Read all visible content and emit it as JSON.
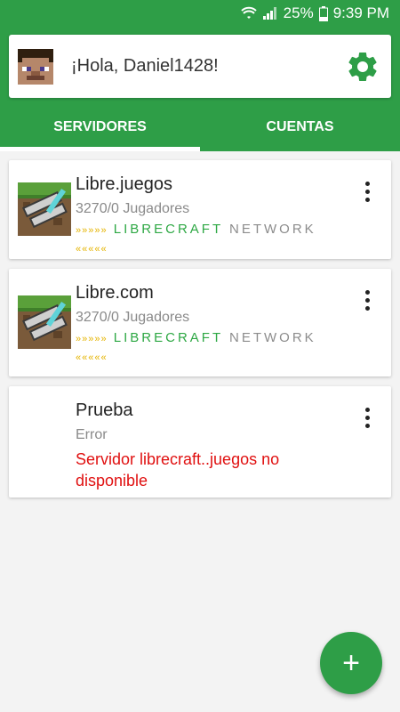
{
  "status_bar": {
    "battery": "25%",
    "time": "9:39 PM",
    "icons": [
      "wifi-icon",
      "signal-icon",
      "battery-icon"
    ]
  },
  "header": {
    "greeting": "¡Hola, Daniel1428!",
    "settings_icon": "gear-icon"
  },
  "tabs": [
    {
      "label": "SERVIDORES",
      "active": true
    },
    {
      "label": "CUENTAS",
      "active": false
    }
  ],
  "servers": [
    {
      "name": "Libre.juegos",
      "players": "3270/0 Jugadores",
      "motd": {
        "arrows_left": "»»»»»",
        "name_green": "LIBRECRAFT",
        "name_gray": "NETWORK",
        "arrows_right": "«««««"
      }
    },
    {
      "name": "Libre.com",
      "players": "3270/0 Jugadores",
      "motd": {
        "arrows_left": "»»»»»",
        "name_green": "LIBRECRAFT",
        "name_gray": "NETWORK",
        "arrows_right": "«««««"
      }
    },
    {
      "name": "Prueba",
      "status": "Error",
      "error_message": "Servidor librecraft..juegos no disponible"
    }
  ],
  "fab": {
    "label": "+"
  },
  "colors": {
    "primary": "#2e9e47",
    "error": "#e01010",
    "accent_yellow": "#e5b400"
  }
}
